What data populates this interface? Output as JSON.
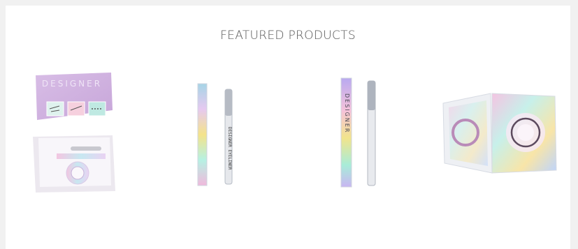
{
  "section": {
    "title": "FEATURED PRODUCTS"
  },
  "products": [
    {
      "name": "Designer lash kit box",
      "box_text": "DESIGNER"
    },
    {
      "name": "Designer eyeliner with box",
      "liner_text": "DESIGNER EYELINER"
    },
    {
      "name": "Designer eyeliner pen with box",
      "box_text": "DESIGNER"
    },
    {
      "name": "Holographic lash case"
    }
  ],
  "colors": {
    "background": "#f1f1f1",
    "panel": "#ffffff",
    "title": "#555555",
    "lilac": "#c9a9d9",
    "holo_pink": "#f5b6d5",
    "holo_teal": "#9fe3e0",
    "holo_blue": "#b5c6ff"
  }
}
